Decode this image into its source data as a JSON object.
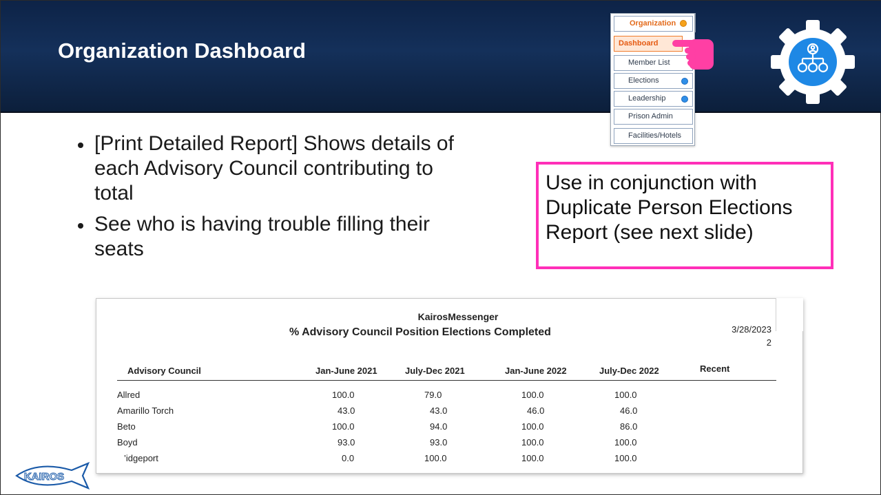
{
  "slide": {
    "title": "Organization Dashboard",
    "bullets": [
      "[Print Detailed Report] Shows details of each Advisory Council contributing to total",
      "See who is having trouble filling their seats"
    ],
    "callout": "Use in conjunction with Duplicate Person Elections Report (see next slide)"
  },
  "menu": {
    "items": [
      {
        "label": "Organization",
        "indicator": "orange"
      },
      {
        "label": "Dashboard",
        "indicator": ""
      },
      {
        "label": "Member List",
        "indicator": ""
      },
      {
        "label": "Elections",
        "indicator": "blue"
      },
      {
        "label": "Leadership",
        "indicator": "blue"
      },
      {
        "label": "Prison Admin",
        "indicator": ""
      },
      {
        "label": "Facilities/Hotels",
        "indicator": ""
      }
    ]
  },
  "icons": {
    "hand": "pointing-hand-icon",
    "gear": "org-gear-icon",
    "logo": "kairos-fish-logo"
  },
  "colors": {
    "header_bg": "#14305a",
    "callout_border": "#ff2fb8",
    "hand": "#ff3fa4",
    "gear_blue": "#1e88e5",
    "menu_active": "#e55a12"
  },
  "report": {
    "org": "KairosMessenger",
    "title": "% Advisory Council Position Elections Completed",
    "date": "3/28/2023",
    "page": "2",
    "columns": [
      "Advisory Council",
      "Jan-June 2021",
      "July-Dec 2021",
      "Jan-June 2022",
      "July-Dec 2022",
      "Recent"
    ],
    "rows": [
      [
        "Allred",
        "100.0",
        "79.0",
        "100.0",
        "100.0",
        ""
      ],
      [
        "Amarillo Torch",
        "43.0",
        "43.0",
        "46.0",
        "46.0",
        ""
      ],
      [
        "Beto",
        "100.0",
        "94.0",
        "100.0",
        "86.0",
        ""
      ],
      [
        "Boyd",
        "93.0",
        "93.0",
        "100.0",
        "100.0",
        ""
      ],
      [
        "’idgeport",
        "0.0",
        "100.0",
        "100.0",
        "100.0",
        ""
      ]
    ]
  },
  "logo_text": "KAIROS"
}
